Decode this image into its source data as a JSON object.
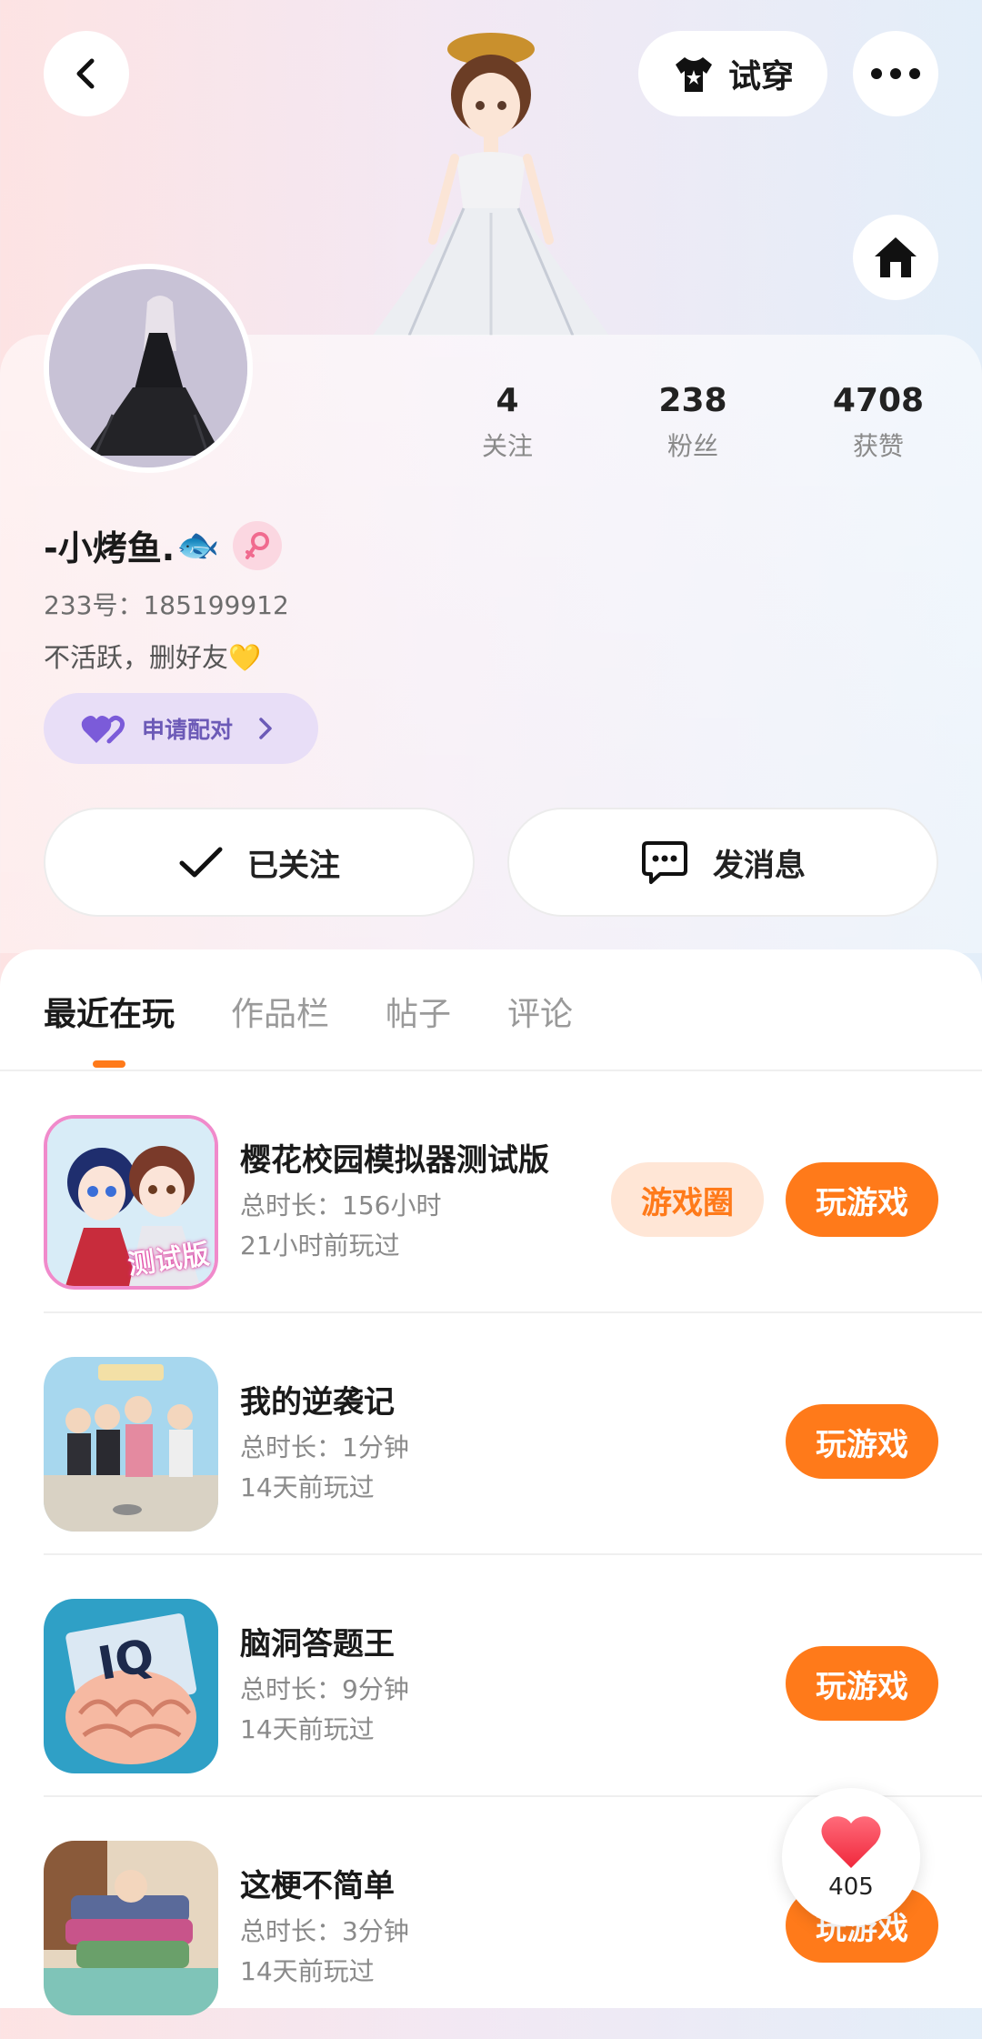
{
  "header": {
    "back_icon": "chevron-left-icon",
    "try_on_label": "试穿",
    "more_icon": "more-dots-icon",
    "home_icon": "home-icon"
  },
  "profile": {
    "stats": [
      {
        "value": "4",
        "label": "关注"
      },
      {
        "value": "238",
        "label": "粉丝"
      },
      {
        "value": "4708",
        "label": "获赞"
      }
    ],
    "nickname": "-小烤鱼.",
    "nickname_emoji": "🐟",
    "uid": "233号：185199912",
    "bio": "不活跃，删好友💛",
    "pair_label": "申请配对",
    "follow_label": "已关注",
    "message_label": "发消息"
  },
  "tabs": [
    {
      "label": "最近在玩",
      "active": true
    },
    {
      "label": "作品栏",
      "active": false
    },
    {
      "label": "帖子",
      "active": false
    },
    {
      "label": "评论",
      "active": false
    }
  ],
  "games": [
    {
      "title": "樱花校园模拟器测试版",
      "duration": "总时长：156小时",
      "last_played": "21小时前玩过",
      "circle_label": "游戏圈",
      "play_label": "玩游戏",
      "icon_text": "测试版"
    },
    {
      "title": "我的逆袭记",
      "duration": "总时长：1分钟",
      "last_played": "14天前玩过",
      "play_label": "玩游戏"
    },
    {
      "title": "脑洞答题王",
      "duration": "总时长：9分钟",
      "last_played": "14天前玩过",
      "play_label": "玩游戏",
      "icon_text": "IQ"
    },
    {
      "title": "这梗不简单",
      "duration": "总时长：3分钟",
      "last_played": "14天前玩过",
      "play_label": "玩游戏"
    }
  ],
  "like_float": {
    "count": "405"
  },
  "colors": {
    "accent": "#ff7a1a",
    "pair": "#6c5ab7"
  }
}
